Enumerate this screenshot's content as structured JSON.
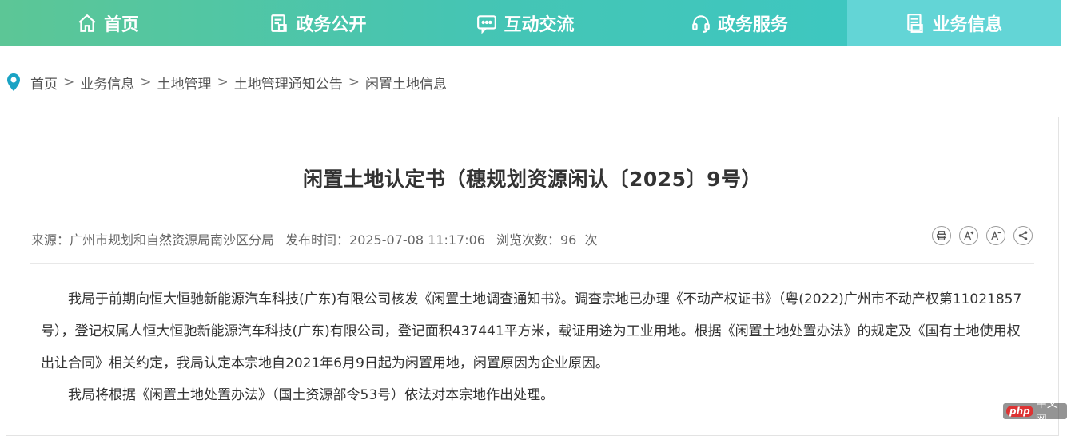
{
  "nav": {
    "items": [
      {
        "label": "首页",
        "icon": "home-icon"
      },
      {
        "label": "政务公开",
        "icon": "document-icon"
      },
      {
        "label": "互动交流",
        "icon": "chat-icon"
      },
      {
        "label": "政务服务",
        "icon": "headset-icon"
      },
      {
        "label": "业务信息",
        "icon": "info-doc-icon"
      }
    ],
    "active_index": 4,
    "colors": {
      "start": "#5cc696",
      "end": "#45cdc8",
      "active": "#63d5d6"
    }
  },
  "breadcrumb": {
    "items": [
      "首页",
      "业务信息",
      "土地管理",
      "土地管理通知公告",
      "闲置土地信息"
    ],
    "separator": ">",
    "pin_color": "#1aa3c4"
  },
  "article": {
    "title": "闲置土地认定书（穗规划资源闲认〔2025〕9号）",
    "source": "来源：广州市规划和自然资源局南沙区分局",
    "published": "发布时间：2025-07-08 11:17:06",
    "views": "浏览次数：96  次",
    "tools": [
      "print-icon",
      "font-increase-icon",
      "font-decrease-icon",
      "share-icon"
    ],
    "paragraphs": [
      "我局于前期向恒大恒驰新能源汽车科技(广东)有限公司核发《闲置土地调查通知书》。调查宗地已办理《不动产权证书》（粤(2022)广州市不动产权第11021857号），登记权属人恒大恒驰新能源汽车科技(广东)有限公司，登记面积437441平方米，载证用途为工业用地。根据《闲置土地处置办法》的规定及《国有土地使用权出让合同》相关约定，我局认定本宗地自2021年6月9日起为闲置用地，闲置原因为企业原因。",
      "我局将根据《闲置土地处置办法》（国土资源部令53号）依法对本宗地作出处理。"
    ]
  },
  "watermark": {
    "badge": "php",
    "text": "中文网"
  }
}
